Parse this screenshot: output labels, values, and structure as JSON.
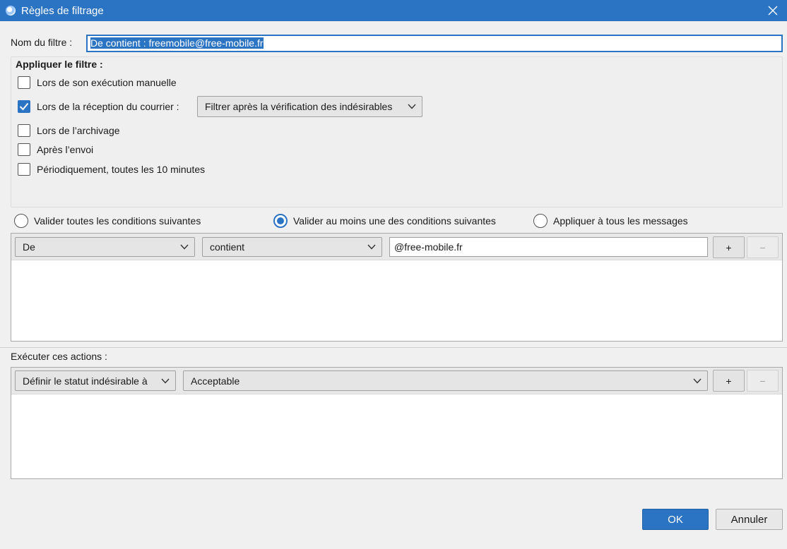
{
  "window": {
    "title": "Règles de filtrage"
  },
  "filter_name": {
    "label": "Nom du filtre :",
    "value": "De contient : freemobile@free-mobile.fr"
  },
  "apply": {
    "title": "Appliquer le filtre :",
    "options": [
      {
        "label": "Lors de son exécution manuelle",
        "checked": false
      },
      {
        "label": "Lors de la réception du courrier :",
        "checked": true
      },
      {
        "label": "Lors de l’archivage",
        "checked": false
      },
      {
        "label": "Après l’envoi",
        "checked": false
      },
      {
        "label": "Périodiquement, toutes les 10 minutes",
        "checked": false
      }
    ],
    "reception_select": "Filtrer après la vérification des indésirables"
  },
  "match": {
    "options": [
      {
        "label": "Valider toutes les conditions suivantes",
        "checked": false
      },
      {
        "label": "Valider au moins une des conditions suivantes",
        "checked": true
      },
      {
        "label": "Appliquer à tous les messages",
        "checked": false
      }
    ]
  },
  "condition": {
    "field": "De",
    "operator": "contient",
    "value": "@free-mobile.fr",
    "add_label": "+",
    "remove_label": "−"
  },
  "actions": {
    "title": "Exécuter ces actions :",
    "action": "Définir le statut indésirable à",
    "value": "Acceptable",
    "add_label": "+",
    "remove_label": "−"
  },
  "buttons": {
    "ok": "OK",
    "cancel": "Annuler"
  },
  "colors": {
    "accent": "#2b73c3",
    "background": "#f0f0f0"
  }
}
